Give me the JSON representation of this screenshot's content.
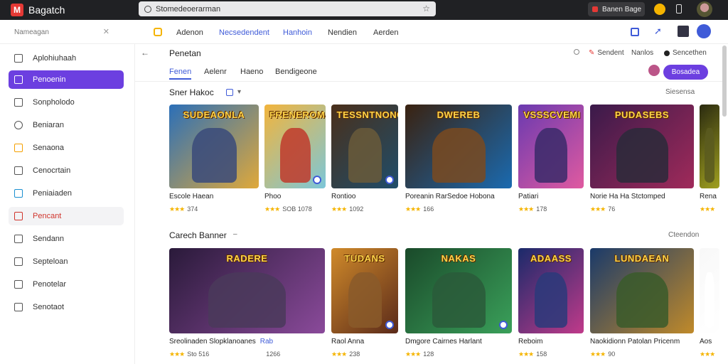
{
  "app": {
    "logo_text": "M",
    "title": "Bagatch"
  },
  "search": {
    "value": "Stomedeoerarman"
  },
  "top_right": {
    "user_label": "Banen  Bage"
  },
  "subheader": {
    "sidebar_search": "Nameagan",
    "tabs": [
      "Adenon",
      "Necsedendent",
      "Hanhoin",
      "Nendien",
      "Aerden"
    ],
    "active_tab": 1
  },
  "sidebar": {
    "items": [
      {
        "label": "Aplohiuhaah",
        "icon": "user-icon"
      },
      {
        "label": "Penoenin",
        "icon": "library-icon",
        "state": "active"
      },
      {
        "label": "Sonpholodo",
        "icon": "document-icon"
      },
      {
        "label": "Beniaran",
        "icon": "clock-icon"
      },
      {
        "label": "Senaona",
        "icon": "folder-icon"
      },
      {
        "label": "Cenocrtain",
        "icon": "cloud-icon"
      },
      {
        "label": "Peniaiaden",
        "icon": "gamepad-icon"
      },
      {
        "label": "Pencant",
        "icon": "flag-icon",
        "state": "hover"
      },
      {
        "label": "Sendann",
        "icon": "chart-icon"
      },
      {
        "label": "Septeloan",
        "icon": "list-icon"
      },
      {
        "label": "Penotelar",
        "icon": "cart-icon"
      },
      {
        "label": "Senotaot",
        "icon": "settings-icon"
      }
    ]
  },
  "main": {
    "title": "Penetan",
    "status": [
      {
        "label": "Sendent",
        "color": "#e53935"
      },
      {
        "label": "Nanlos",
        "color": "#888888"
      },
      {
        "label": "Sencethen",
        "color": "#222222"
      }
    ],
    "subtabs": [
      "Fenen",
      "Aelenr",
      "Haeno",
      "Bendigeone"
    ],
    "active_subtab": 0,
    "primary_button": "Bosadea",
    "rows": [
      {
        "title": "Sner Hakoc",
        "more": "Siesensa",
        "cards": [
          {
            "name": "Escole Haean",
            "rating": "374",
            "banner": "SUDEAONLA",
            "bg1": "#2b6fb8",
            "bg2": "#e0a93a",
            "fig": "#3a4a7a"
          },
          {
            "name": "Phoo",
            "rating": "SOB  1078",
            "banner": "FRENEROMA",
            "bg1": "#f2b43c",
            "bg2": "#7cc7d9",
            "fig": "#c0392b"
          },
          {
            "name": "Rontioo",
            "rating": "1092",
            "banner": "TESSNTNONO",
            "bg1": "#4a2f1a",
            "bg2": "#1f4d6a",
            "fig": "#6a5a3a"
          },
          {
            "name": "Poreanin RarSedoe Hobona",
            "rating": "166",
            "banner": "DWEREB",
            "bg1": "#3a2210",
            "bg2": "#1a6ab0",
            "fig": "#7a4a20"
          },
          {
            "name": "Patiari",
            "rating": "178",
            "banner": "VSSSCVEMI",
            "bg1": "#6a3ab0",
            "bg2": "#e05aa0",
            "fig": "#3a2a6a"
          },
          {
            "name": "Norie Ha Ha Stctomped",
            "rating": "76",
            "banner": "PUDASEBS",
            "bg1": "#3a1a4a",
            "bg2": "#a02a5a",
            "fig": "#2a2a3a"
          },
          {
            "name": "Rena",
            "rating": "",
            "banner": "",
            "bg1": "#2a2a10",
            "bg2": "#a0a020",
            "fig": "#5a5a20"
          }
        ]
      },
      {
        "title": "Carech Banner",
        "more": "Cteendon",
        "cards": [
          {
            "name": "Sreolinaden Slopklanoanes",
            "tag": "Rab",
            "rating": "Sto  516",
            "rating2": "1266",
            "banner": "RADERE",
            "bg1": "#2a1a3a",
            "bg2": "#8a4a9a",
            "fig": "#4a3a5a"
          },
          {
            "name": "Raol Anna",
            "rating": "238",
            "banner": "TUDANS",
            "bg1": "#d08a2a",
            "bg2": "#5a2a1a",
            "fig": "#8a5a2a"
          },
          {
            "name": "Dmgore Cairnes Harlant",
            "rating": "128",
            "banner": "NAKAS",
            "bg1": "#1a4a2a",
            "bg2": "#3aa05a",
            "fig": "#2a5a3a"
          },
          {
            "name": "Reboim",
            "rating": "158",
            "banner": "ADAASS",
            "bg1": "#1a2a6a",
            "bg2": "#c03a8a",
            "fig": "#2a3a7a"
          },
          {
            "name": "Naokidionn Patolan Pricenm",
            "rating": "90",
            "banner": "LUNDAEAN",
            "bg1": "#1a3a6a",
            "bg2": "#c08a2a",
            "fig": "#3a5a2a"
          },
          {
            "name": "Aos",
            "rating": "",
            "banner": "",
            "bg1": "#f8f8f8",
            "bg2": "#ffffff",
            "fig": "#ffffff"
          }
        ]
      }
    ]
  }
}
